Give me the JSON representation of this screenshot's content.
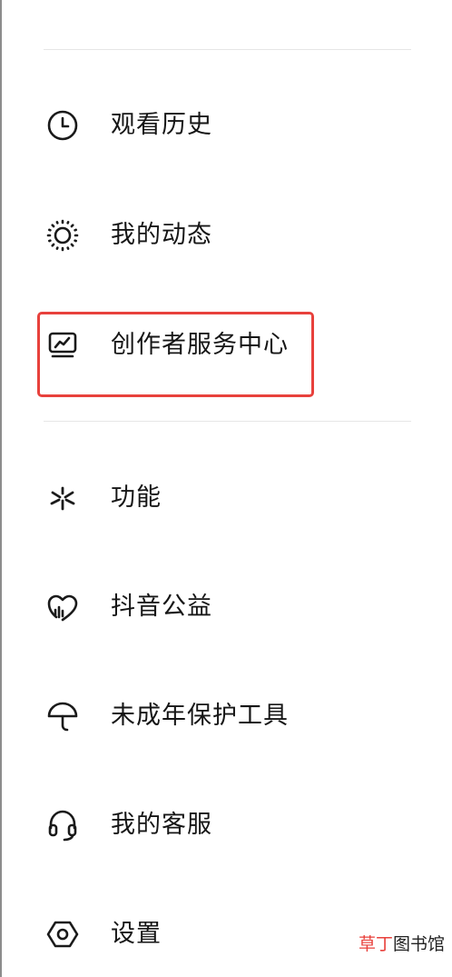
{
  "menu": {
    "items": [
      {
        "label": "观看历史",
        "icon": "clock-icon"
      },
      {
        "label": "我的动态",
        "icon": "sun-icon"
      },
      {
        "label": "创作者服务中心",
        "icon": "chart-monitor-icon"
      },
      {
        "label": "功能",
        "icon": "sparkle-icon"
      },
      {
        "label": "抖音公益",
        "icon": "heart-icon"
      },
      {
        "label": "未成年保护工具",
        "icon": "umbrella-icon"
      },
      {
        "label": "我的客服",
        "icon": "headset-icon"
      },
      {
        "label": "设置",
        "icon": "hexagon-gear-icon"
      }
    ]
  },
  "annotation": {
    "highlight_color": "#e8413c"
  },
  "watermark": {
    "part1": "草丁",
    "part2": "图书馆"
  },
  "colors": {
    "text": "#161616",
    "divider": "#e6e6e6",
    "background": "#ffffff"
  }
}
